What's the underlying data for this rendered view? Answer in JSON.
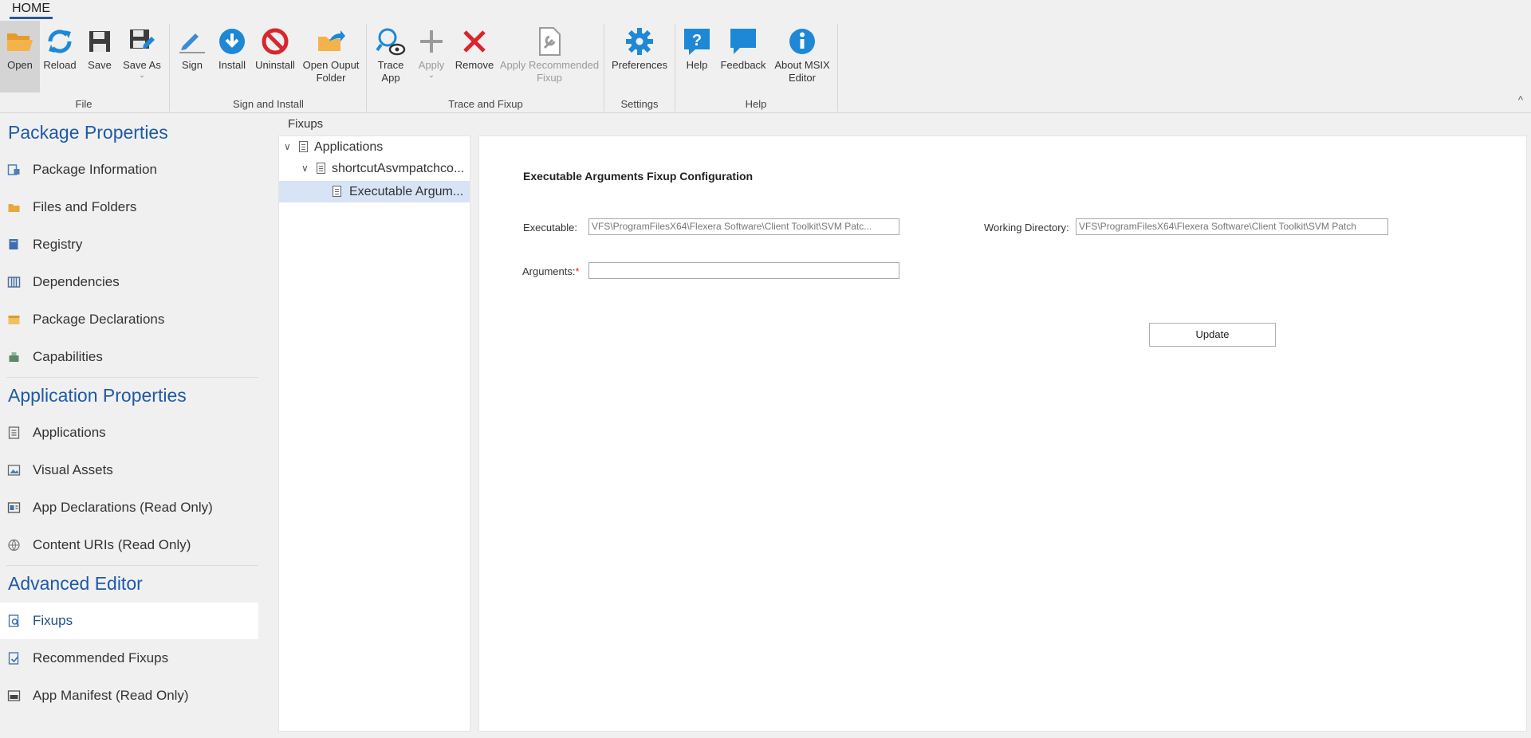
{
  "ribbon": {
    "tab": "HOME",
    "groups": {
      "file": {
        "label": "File",
        "open": "Open",
        "reload": "Reload",
        "save": "Save",
        "save_as": "Save As"
      },
      "sign_install": {
        "label": "Sign and Install",
        "sign": "Sign",
        "install": "Install",
        "uninstall": "Uninstall",
        "open_output_line1": "Open Ouput",
        "open_output_line2": "Folder"
      },
      "trace_fixup": {
        "label": "Trace and Fixup",
        "trace_line1": "Trace",
        "trace_line2": "App",
        "apply": "Apply",
        "remove": "Remove",
        "apply_rec_line1": "Apply Recommended",
        "apply_rec_line2": "Fixup"
      },
      "settings": {
        "label": "Settings",
        "preferences": "Preferences"
      },
      "help": {
        "label": "Help",
        "help": "Help",
        "feedback": "Feedback",
        "about_line1": "About MSIX",
        "about_line2": "Editor"
      }
    },
    "collapse_glyph": "^"
  },
  "sidebar": {
    "sections": [
      {
        "header": "Package Properties",
        "items": [
          "Package Information",
          "Files and Folders",
          "Registry",
          "Dependencies",
          "Package Declarations",
          "Capabilities"
        ]
      },
      {
        "header": "Application Properties",
        "items": [
          "Applications",
          "Visual Assets",
          "App Declarations (Read Only)",
          "Content URIs (Read Only)"
        ]
      },
      {
        "header": "Advanced Editor",
        "items": [
          "Fixups",
          "Recommended Fixups",
          "App Manifest (Read Only)"
        ]
      }
    ],
    "selected": "Fixups"
  },
  "main": {
    "panel_title": "Fixups",
    "tree": {
      "root": "Applications",
      "child": "shortcutAsvmpatchco...",
      "leaf": "Executable Argum..."
    },
    "config": {
      "title": "Executable Arguments Fixup Configuration",
      "executable_label": "Executable:",
      "executable_value": "VFS\\ProgramFilesX64\\Flexera Software\\Client Toolkit\\SVM Patc...",
      "working_dir_label": "Working Directory:",
      "working_dir_value": "VFS\\ProgramFilesX64\\Flexera Software\\Client Toolkit\\SVM Patch",
      "arguments_label": "Arguments:",
      "required_marker": "*",
      "arguments_value": "",
      "update_button": "Update"
    }
  },
  "colors": {
    "accent": "#1e5aa8",
    "icon_blue": "#1e88d6",
    "icon_red": "#d9262c",
    "icon_orange": "#f0a030",
    "selected_tree": "#d6e4f5"
  }
}
